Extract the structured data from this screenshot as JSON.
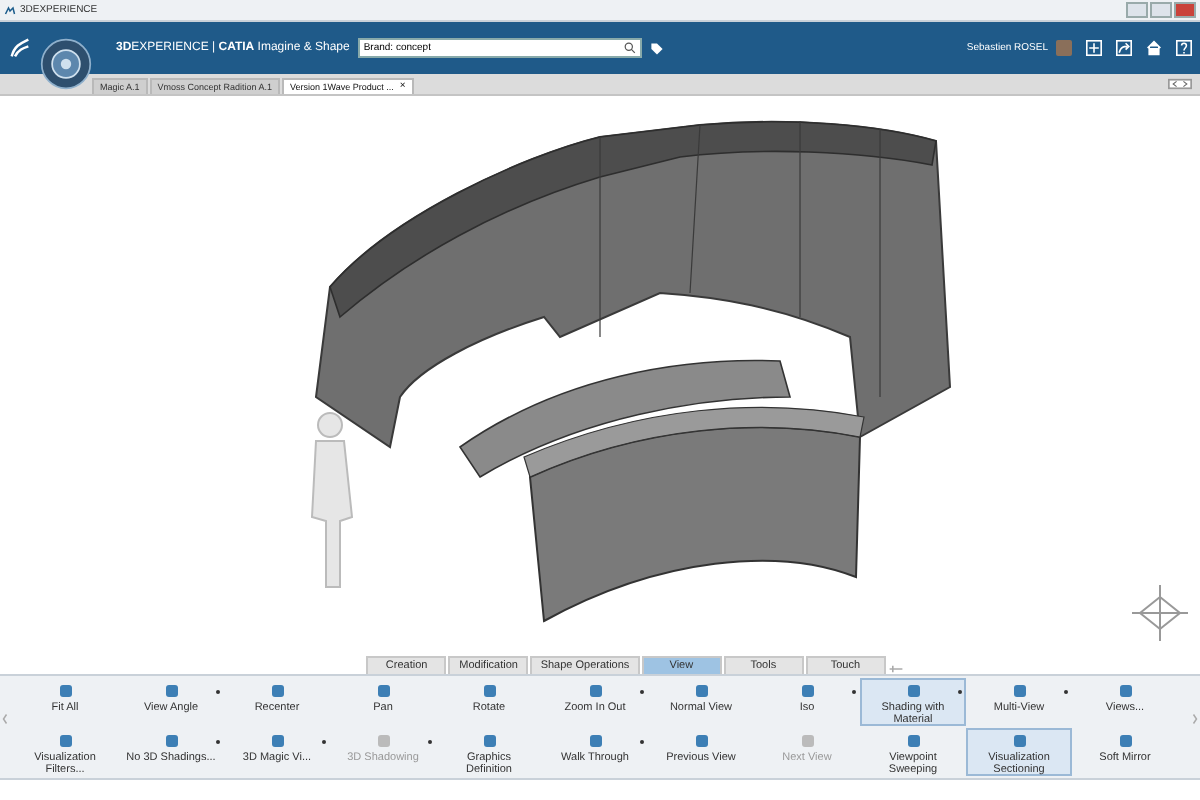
{
  "window": {
    "title": "3DEXPERIENCE"
  },
  "header": {
    "brand": "**3D**EXPERIENCE | **CATIA** Imagine & Shape",
    "search": {
      "value": "Brand: concept"
    },
    "user": "Sebastien ROSEL"
  },
  "doc_tabs": [
    {
      "label": "Magic A.1",
      "selected": false,
      "closable": false
    },
    {
      "label": "Vmoss Concept Radition A.1",
      "selected": false,
      "closable": false
    },
    {
      "label": "Version 1Wave Product ...",
      "selected": true,
      "closable": true
    }
  ],
  "close_glyph": "×",
  "action_tabs": [
    {
      "label": "Creation",
      "selected": false
    },
    {
      "label": "Modification",
      "selected": false
    },
    {
      "label": "Shape Operations",
      "selected": false
    },
    {
      "label": "View",
      "selected": true
    },
    {
      "label": "Tools",
      "selected": false
    },
    {
      "label": "Touch",
      "selected": false
    }
  ],
  "toolbar": [
    {
      "label": "Fit All",
      "dropdown": false,
      "disabled": false,
      "selected": false
    },
    {
      "label": "View Angle",
      "dropdown": true,
      "disabled": false,
      "selected": false
    },
    {
      "label": "Recenter",
      "dropdown": false,
      "disabled": false,
      "selected": false
    },
    {
      "label": "Pan",
      "dropdown": false,
      "disabled": false,
      "selected": false
    },
    {
      "label": "Rotate",
      "dropdown": false,
      "disabled": false,
      "selected": false
    },
    {
      "label": "Zoom In Out",
      "dropdown": true,
      "disabled": false,
      "selected": false
    },
    {
      "label": "Normal View",
      "dropdown": false,
      "disabled": false,
      "selected": false
    },
    {
      "label": "Iso",
      "dropdown": true,
      "disabled": false,
      "selected": false
    },
    {
      "label": "Shading with Material",
      "dropdown": true,
      "disabled": false,
      "selected": true
    },
    {
      "label": "Multi-View",
      "dropdown": true,
      "disabled": false,
      "selected": false
    },
    {
      "label": "Views...",
      "dropdown": false,
      "disabled": false,
      "selected": false
    },
    {
      "label": "Visualization Filters...",
      "dropdown": false,
      "disabled": false,
      "selected": false
    },
    {
      "label": "No 3D Shadings...",
      "dropdown": true,
      "disabled": false,
      "selected": false
    },
    {
      "label": "3D Magic Vi...",
      "dropdown": true,
      "disabled": false,
      "selected": false
    },
    {
      "label": "3D Shadowing",
      "dropdown": true,
      "disabled": true,
      "selected": false
    },
    {
      "label": "Graphics Definition",
      "dropdown": false,
      "disabled": false,
      "selected": false
    },
    {
      "label": "Walk Through",
      "dropdown": true,
      "disabled": false,
      "selected": false
    },
    {
      "label": "Previous View",
      "dropdown": false,
      "disabled": false,
      "selected": false
    },
    {
      "label": "Next View",
      "dropdown": false,
      "disabled": true,
      "selected": false
    },
    {
      "label": "Viewpoint Sweeping",
      "dropdown": false,
      "disabled": false,
      "selected": false
    },
    {
      "label": "Visualization Sectioning",
      "dropdown": false,
      "disabled": false,
      "selected": true
    },
    {
      "label": "Soft Mirror",
      "dropdown": false,
      "disabled": false,
      "selected": false
    }
  ]
}
